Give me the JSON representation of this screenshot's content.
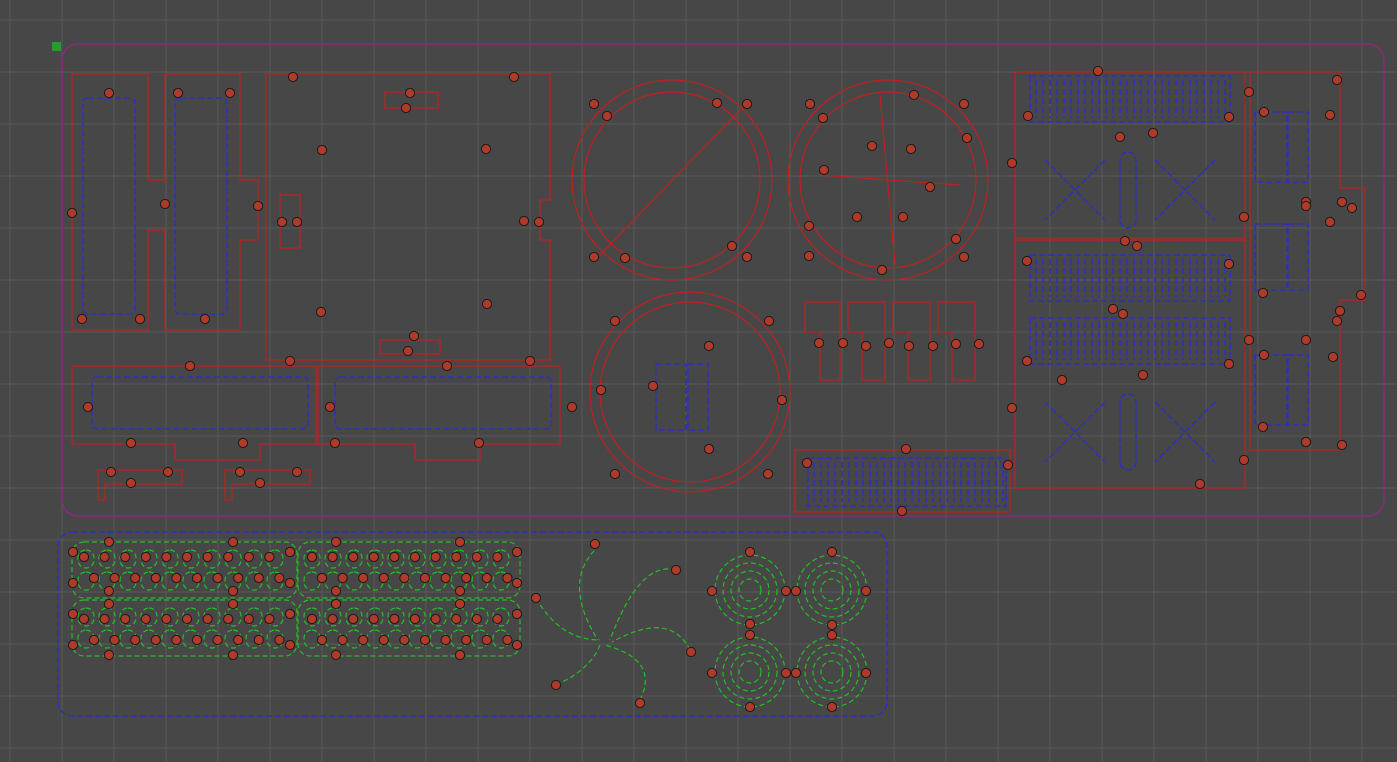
{
  "canvas": {
    "background": "#474747",
    "grid_color": "#5a5a5a",
    "colors": {
      "stock_border": "#8a2a7a",
      "cut_outline": "#c02020",
      "inner_cut": "#2a2ad8",
      "engrave": "#22c022",
      "hole_fill": "#b03a2a",
      "hole_stroke": "#1a1a1a",
      "origin_marker": "#2a9a2a"
    }
  },
  "layers": [
    {
      "name": "stock-border",
      "icon": "rounded-rect"
    },
    {
      "name": "outer-cuts",
      "icon": "red-dashed-line"
    },
    {
      "name": "inner-cuts",
      "icon": "blue-dashed-line"
    },
    {
      "name": "engrave",
      "icon": "green-dashed-line"
    },
    {
      "name": "drill-points",
      "icon": "red-dot"
    }
  ]
}
